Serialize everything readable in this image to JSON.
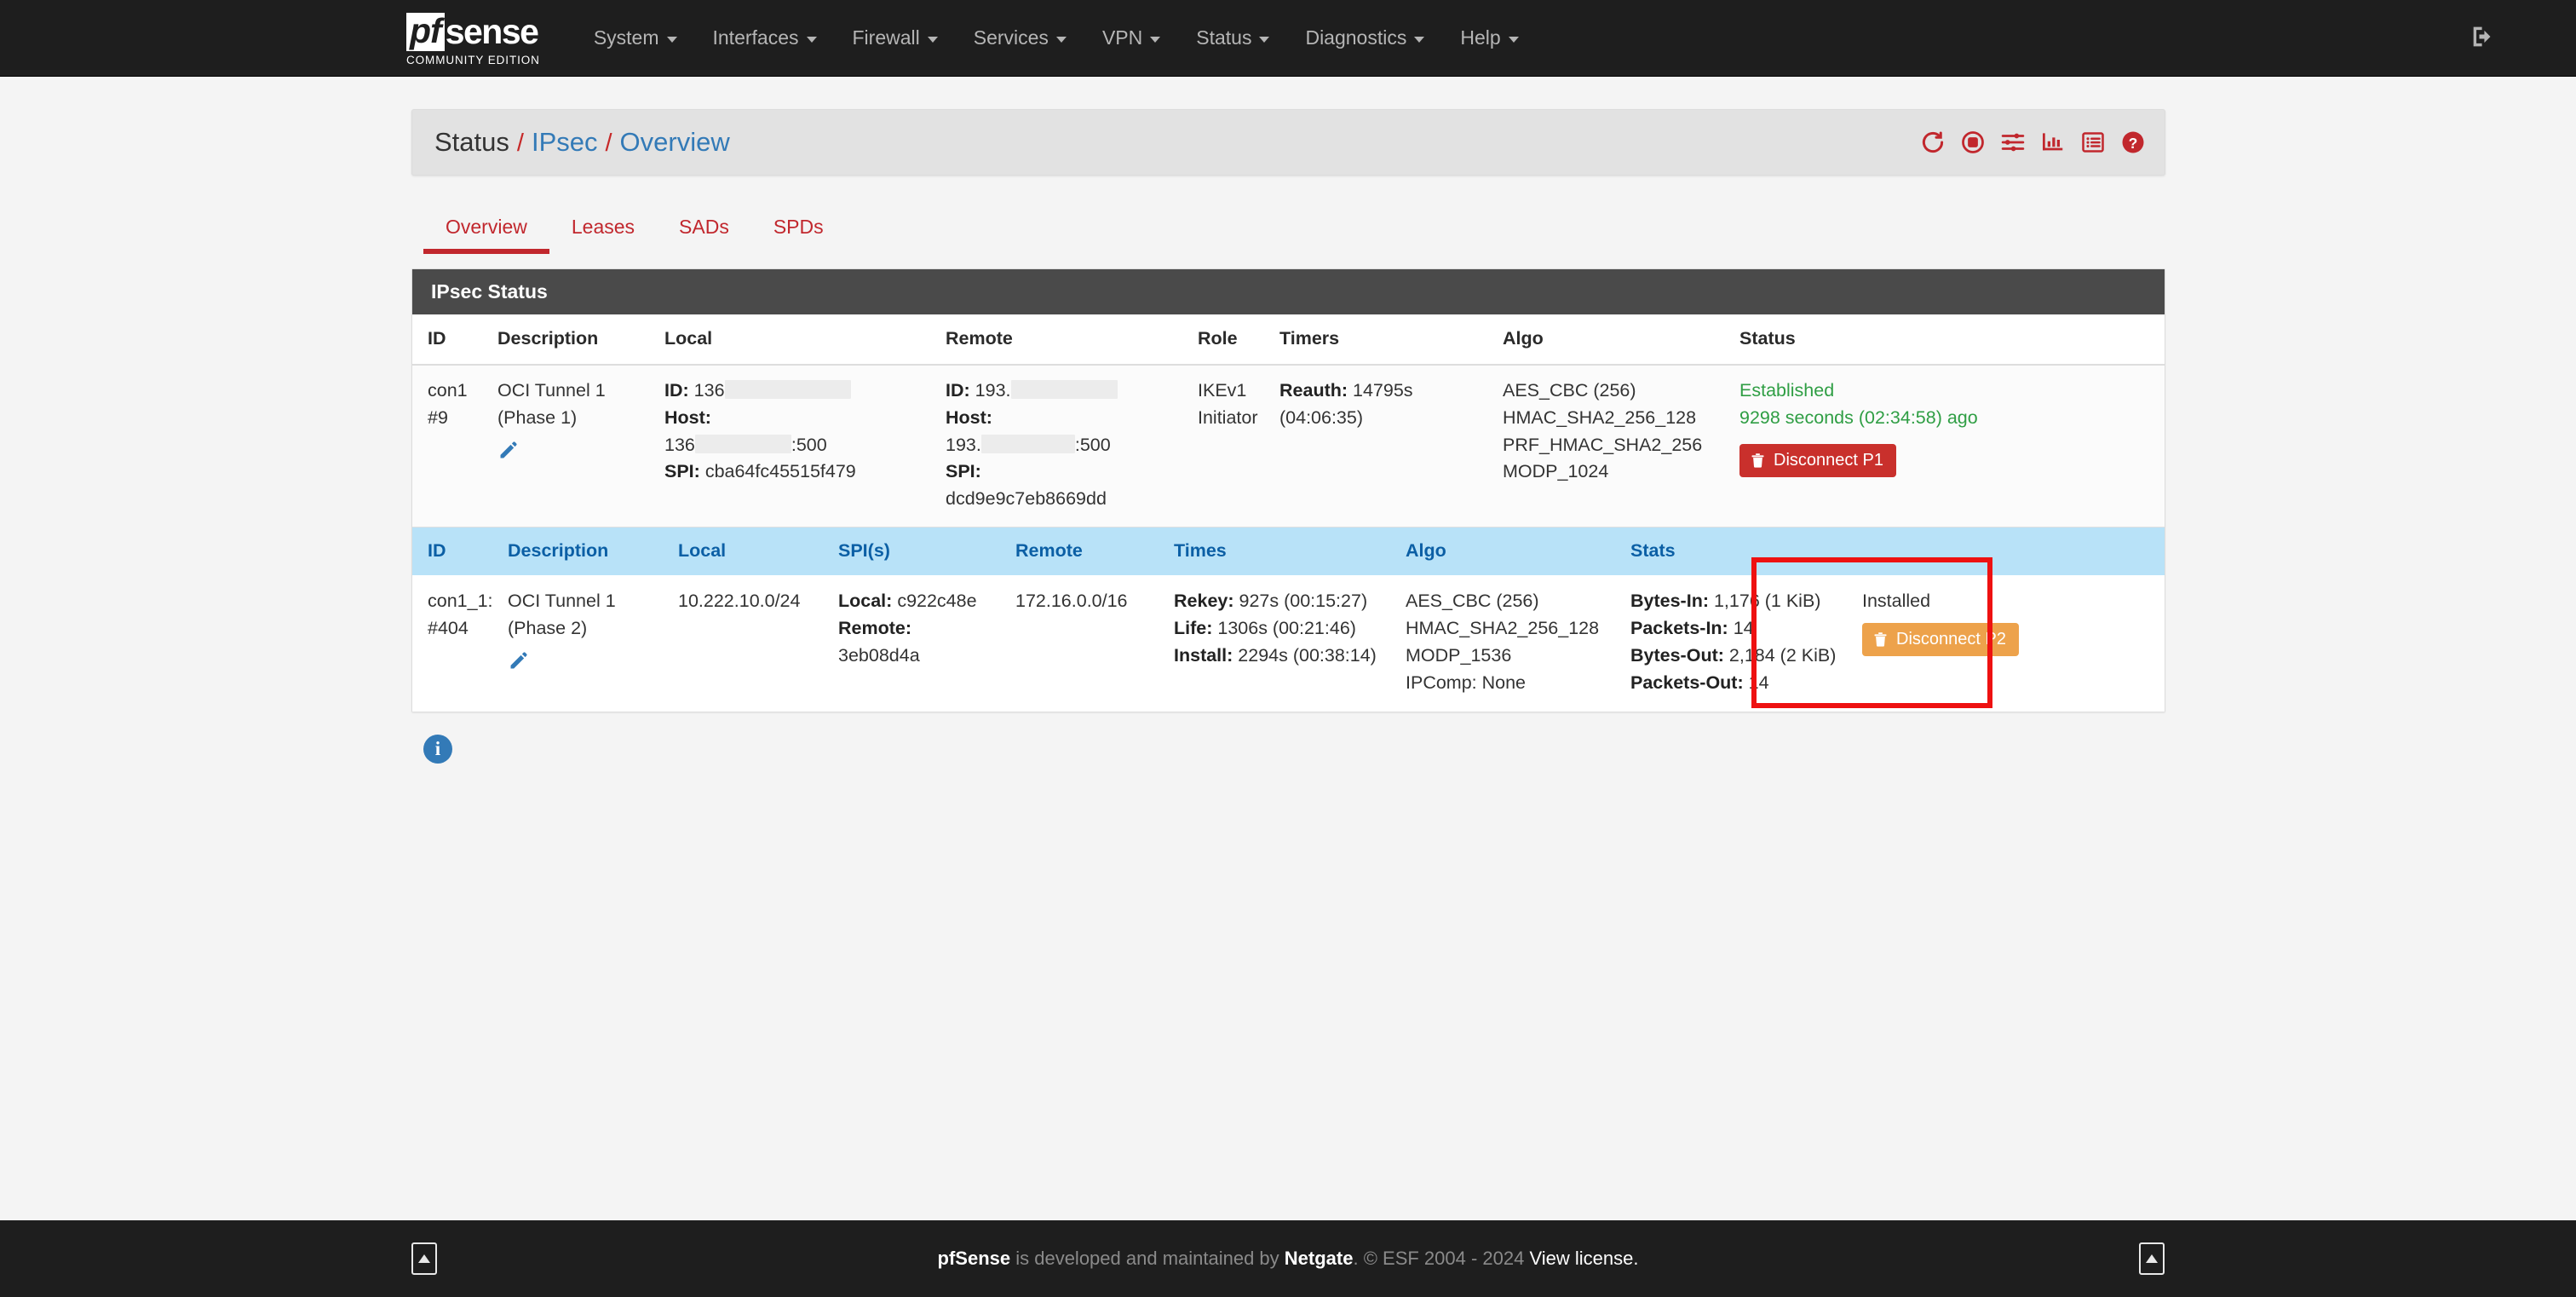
{
  "brand": {
    "name_pf": "pf",
    "name_sense": "sense",
    "edition": "COMMUNITY EDITION"
  },
  "nav": {
    "items": [
      {
        "label": "System",
        "caret": true
      },
      {
        "label": "Interfaces",
        "caret": true
      },
      {
        "label": "Firewall",
        "caret": true
      },
      {
        "label": "Services",
        "caret": true
      },
      {
        "label": "VPN",
        "caret": true
      },
      {
        "label": "Status",
        "caret": true
      },
      {
        "label": "Diagnostics",
        "caret": true
      },
      {
        "label": "Help",
        "caret": true
      }
    ],
    "logout_icon": "sign-out-icon"
  },
  "breadcrumb": {
    "root": "Status",
    "sep": "/",
    "section": "IPsec",
    "page": "Overview"
  },
  "head_icons": [
    {
      "name": "refresh-icon",
      "title": "Refresh"
    },
    {
      "name": "stop-circle-icon",
      "title": "Pause"
    },
    {
      "name": "sliders-icon",
      "title": "Settings"
    },
    {
      "name": "chart-bar-icon",
      "title": "Graphs"
    },
    {
      "name": "list-alt-icon",
      "title": "Logs"
    },
    {
      "name": "question-circle-icon",
      "title": "Help"
    }
  ],
  "tabs": [
    {
      "label": "Overview",
      "active": true
    },
    {
      "label": "Leases",
      "active": false
    },
    {
      "label": "SADs",
      "active": false
    },
    {
      "label": "SPDs",
      "active": false
    }
  ],
  "panel": {
    "title": "IPsec Status"
  },
  "phase1": {
    "columns": [
      "ID",
      "Description",
      "Local",
      "Remote",
      "Role",
      "Timers",
      "Algo",
      "Status"
    ],
    "row": {
      "id_line1": "con1",
      "id_line2": "#9",
      "description": "OCI Tunnel 1 (Phase 1)",
      "edit_icon": "pencil-icon",
      "local": {
        "id_label": "ID:",
        "id_value": "136",
        "host_label": "Host:",
        "host_value": "136",
        "host_port": ":500",
        "spi_label": "SPI:",
        "spi_value": "cba64fc45515f479"
      },
      "remote": {
        "id_label": "ID:",
        "id_value": "193.",
        "host_label": "Host:",
        "host_value": "193.",
        "host_port": ":500",
        "spi_label": "SPI:",
        "spi_value": "dcd9e9c7eb8669dd"
      },
      "role_line1": "IKEv1",
      "role_line2": "Initiator",
      "timers": {
        "reauth_label": "Reauth:",
        "reauth_value": "14795s",
        "reauth_time": "(04:06:35)"
      },
      "algo": [
        "AES_CBC (256)",
        "HMAC_SHA2_256_128",
        "PRF_HMAC_SHA2_256",
        "MODP_1024"
      ],
      "status": {
        "state": "Established",
        "uptime": "9298 seconds (02:34:58) ago",
        "disconnect_label": "Disconnect P1",
        "disconnect_icon": "trash-icon"
      }
    }
  },
  "phase2": {
    "columns": [
      "ID",
      "Description",
      "Local",
      "SPI(s)",
      "Remote",
      "Times",
      "Algo",
      "Stats",
      ""
    ],
    "row": {
      "id_line1": "con1_1:",
      "id_line2": "#404",
      "description": "OCI Tunnel 1 (Phase 2)",
      "edit_icon": "pencil-icon",
      "local": "10.222.10.0/24",
      "spi": {
        "local_label": "Local:",
        "local_value": "c922c48e",
        "remote_label": "Remote:",
        "remote_value": "3eb08d4a"
      },
      "remote": "172.16.0.0/16",
      "times": {
        "rekey_label": "Rekey:",
        "rekey_value": "927s (00:15:27)",
        "life_label": "Life:",
        "life_value": "1306s (00:21:46)",
        "install_label": "Install:",
        "install_value": "2294s (00:38:14)"
      },
      "algo": [
        "AES_CBC (256)",
        "HMAC_SHA2_256_128",
        "MODP_1536",
        "IPComp: None"
      ],
      "stats": {
        "bytes_in_label": "Bytes-In:",
        "bytes_in_value": "1,176 (1 KiB)",
        "packets_in_label": "Packets-In:",
        "packets_in_value": "14",
        "bytes_out_label": "Bytes-Out:",
        "bytes_out_value": "2,184 (2 KiB)",
        "packets_out_label": "Packets-Out:",
        "packets_out_value": "14"
      },
      "state": "Installed",
      "disconnect_label": "Disconnect P2",
      "disconnect_icon": "trash-icon"
    }
  },
  "info": {
    "icon": "info-circle-icon",
    "glyph": "i"
  },
  "footer": {
    "brand": "pfSense",
    "text_mid": " is developed and maintained by ",
    "company": "Netgate",
    "copyright": ". © ESF 2004 - 2024 ",
    "license": "View license."
  },
  "colors": {
    "accent_red": "#c1272d",
    "link_blue": "#337ab7",
    "header_blue_bg": "#b8e2f8",
    "header_blue_text": "#0b5fa5",
    "status_green": "#2f9e44",
    "danger": "#c9302c",
    "warning": "#eda24b",
    "highlight_box": "#ee1111",
    "navbar_bg": "#1e1e1e"
  }
}
